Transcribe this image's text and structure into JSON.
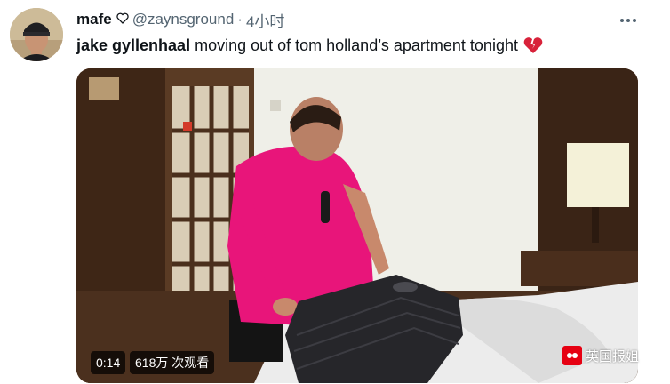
{
  "tweet": {
    "display_name": "mafe",
    "handle": "@zaynsground",
    "separator": "·",
    "timestamp": "4小时",
    "text_strong": "jake gyllenhaal",
    "text_rest": "moving out of tom holland’s apartment tonight",
    "emoji": "broken-heart"
  },
  "video": {
    "duration": "0:14",
    "views": "618万 次观看"
  },
  "watermark": {
    "text": "英国报姐"
  },
  "icons": {
    "more": "more-horizontal-icon",
    "verified_heart": "heart-outline-icon"
  },
  "colors": {
    "text": "#0f1419",
    "secondary": "#536471",
    "shirt": "#e8157a",
    "emoji_red": "#d8223a"
  }
}
